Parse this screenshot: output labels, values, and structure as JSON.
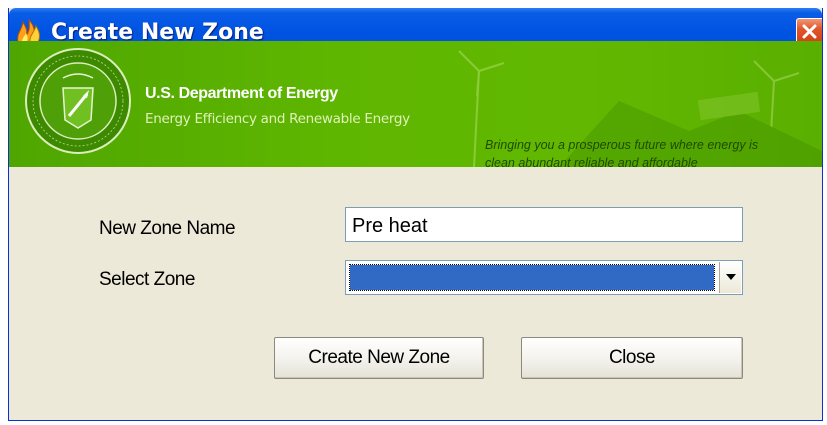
{
  "window": {
    "title": "Create New Zone"
  },
  "banner": {
    "department": "U.S. Department of Energy",
    "subtitle": "Energy Efficiency and Renewable Energy",
    "tagline_line1": "Bringing you a prosperous future where energy is",
    "tagline_line2": "clean abundant reliable and affordable",
    "seal_icon": "doe-seal-icon",
    "colors": {
      "banner_green": "#5fb600",
      "titlebar_blue": "#0053e1"
    }
  },
  "form": {
    "zone_name_label": "New Zone Name",
    "zone_name_value": "Pre heat",
    "select_zone_label": "Select Zone",
    "select_zone_value": ""
  },
  "buttons": {
    "create_label": "Create New Zone",
    "close_label": "Close"
  },
  "icons": {
    "app": "flame-app-icon",
    "close": "close-icon",
    "dropdown": "chevron-down-icon"
  }
}
